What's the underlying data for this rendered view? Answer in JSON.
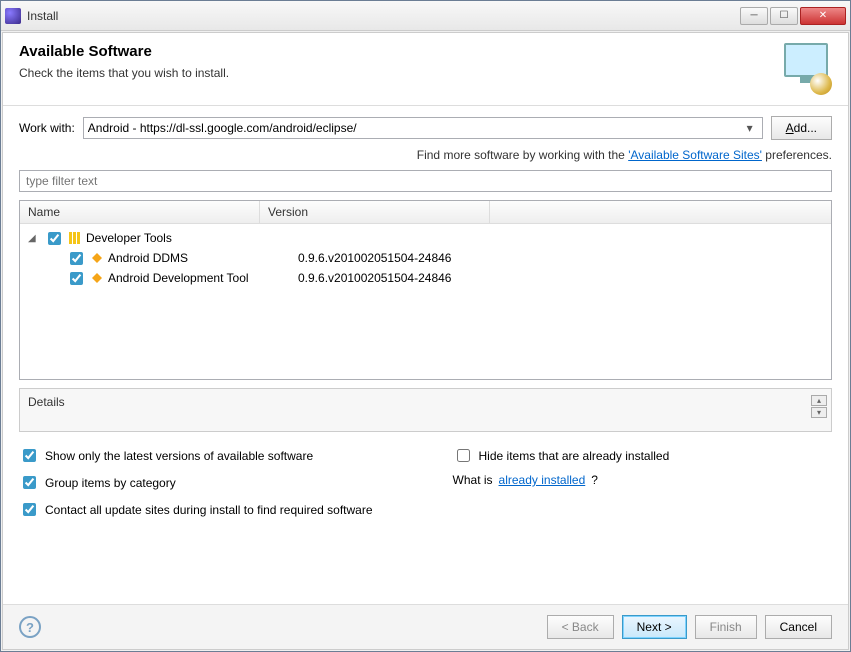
{
  "window": {
    "title": "Install"
  },
  "header": {
    "title": "Available Software",
    "subtitle": "Check the items that you wish to install."
  },
  "work_with": {
    "label": "Work with:",
    "value": "Android - https://dl-ssl.google.com/android/eclipse/",
    "add_button": "Add..."
  },
  "hint": {
    "prefix": "Find more software by working with the ",
    "link": "'Available Software Sites'",
    "suffix": " preferences."
  },
  "filter_placeholder": "type filter text",
  "columns": {
    "name": "Name",
    "version": "Version"
  },
  "tree": {
    "root": {
      "label": "Developer Tools",
      "checked": true,
      "expanded": true
    },
    "children": [
      {
        "label": "Android DDMS",
        "version": "0.9.6.v201002051504-24846",
        "checked": true
      },
      {
        "label": "Android Development Tool",
        "version": "0.9.6.v201002051504-24846",
        "checked": true
      }
    ]
  },
  "details_label": "Details",
  "options": {
    "show_latest": {
      "label": "Show only the latest versions of available software",
      "checked": true
    },
    "group_category": {
      "label": "Group items by category",
      "checked": true
    },
    "contact_sites": {
      "label": "Contact all update sites during install to find required software",
      "checked": true
    },
    "hide_installed": {
      "label": "Hide items that are already installed",
      "checked": false
    },
    "what_is_prefix": "What is ",
    "what_is_link": "already installed",
    "what_is_suffix": "?"
  },
  "buttons": {
    "back": "< Back",
    "next": "Next >",
    "finish": "Finish",
    "cancel": "Cancel"
  }
}
